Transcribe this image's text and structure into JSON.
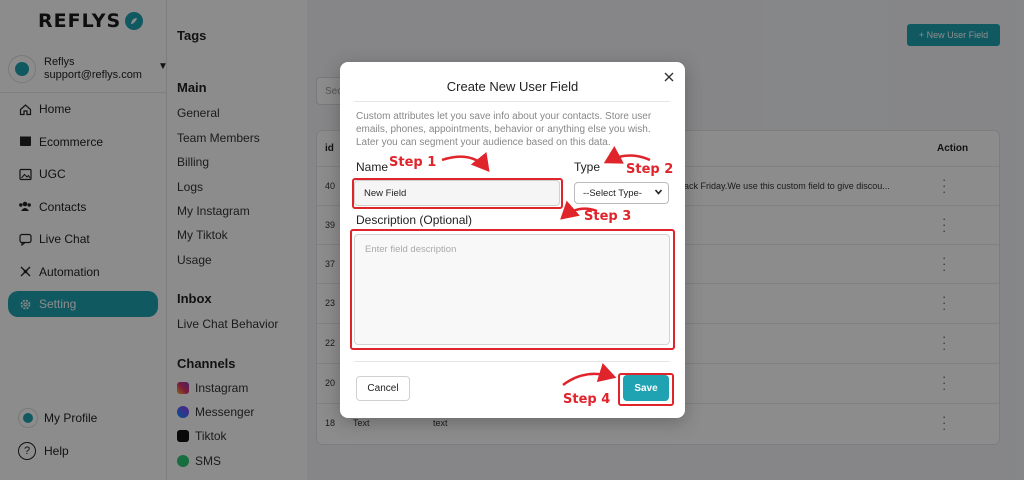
{
  "brand": {
    "name": "REFLYS"
  },
  "account": {
    "name": "Reflys",
    "email": "support@reflys.com"
  },
  "sidebar": {
    "items": [
      {
        "label": "Home",
        "icon": "home-icon"
      },
      {
        "label": "Ecommerce",
        "icon": "store-icon"
      },
      {
        "label": "UGC",
        "icon": "image-icon"
      },
      {
        "label": "Contacts",
        "icon": "users-icon"
      },
      {
        "label": "Live Chat",
        "icon": "chat-icon"
      },
      {
        "label": "Automation",
        "icon": "automation-icon"
      },
      {
        "label": "Setting",
        "icon": "gear-icon",
        "active": true
      }
    ],
    "bottom": [
      {
        "label": "My Profile",
        "icon": "avatar"
      },
      {
        "label": "Help",
        "icon": "help-icon"
      }
    ]
  },
  "settings_nav": {
    "page_title": "Tags",
    "main_heading": "Main",
    "main_items": [
      "General",
      "Team Members",
      "Billing",
      "Logs",
      "My Instagram",
      "My Tiktok",
      "Usage"
    ],
    "inbox_heading": "Inbox",
    "inbox_items": [
      "Live Chat Behavior"
    ],
    "channels_heading": "Channels",
    "channel_items": [
      "Instagram",
      "Messenger",
      "Tiktok",
      "SMS"
    ]
  },
  "toolbar": {
    "new_button": "+ New User Field",
    "search_placeholder": "Sec"
  },
  "table": {
    "headers": {
      "id": "id",
      "action": "Action"
    },
    "rows": [
      {
        "id": "40",
        "type": "",
        "name": "",
        "desc": "black Friday.We use this custom field to give discou..."
      },
      {
        "id": "39",
        "type": "",
        "name": "",
        "desc": ""
      },
      {
        "id": "37",
        "type": "",
        "name": "",
        "desc": ""
      },
      {
        "id": "23",
        "type": "",
        "name": "",
        "desc": ""
      },
      {
        "id": "22",
        "type": "",
        "name": "",
        "desc": ""
      },
      {
        "id": "20",
        "type": "",
        "name": "",
        "desc": ""
      },
      {
        "id": "18",
        "type": "Text",
        "name": "text",
        "desc": ""
      }
    ]
  },
  "modal": {
    "title": "Create New User Field",
    "description": "Custom attributes let you save info about your contacts. Store user emails, phones, appointments, behavior or anything else you wish. Later you can segment your audience based on this data.",
    "name_label": "Name",
    "name_value": "New Field",
    "type_label": "Type",
    "type_selected": "--Select Type-",
    "description_label": "Description (Optional)",
    "description_placeholder": "Enter field description",
    "cancel_label": "Cancel",
    "save_label": "Save"
  },
  "annotations": {
    "step1": "Step 1",
    "step2": "Step 2",
    "step3": "Step 3",
    "step4": "Step 4",
    "color": "#e0242c"
  },
  "colors": {
    "accent": "#1fa2b1",
    "annotation": "#e0242c"
  }
}
